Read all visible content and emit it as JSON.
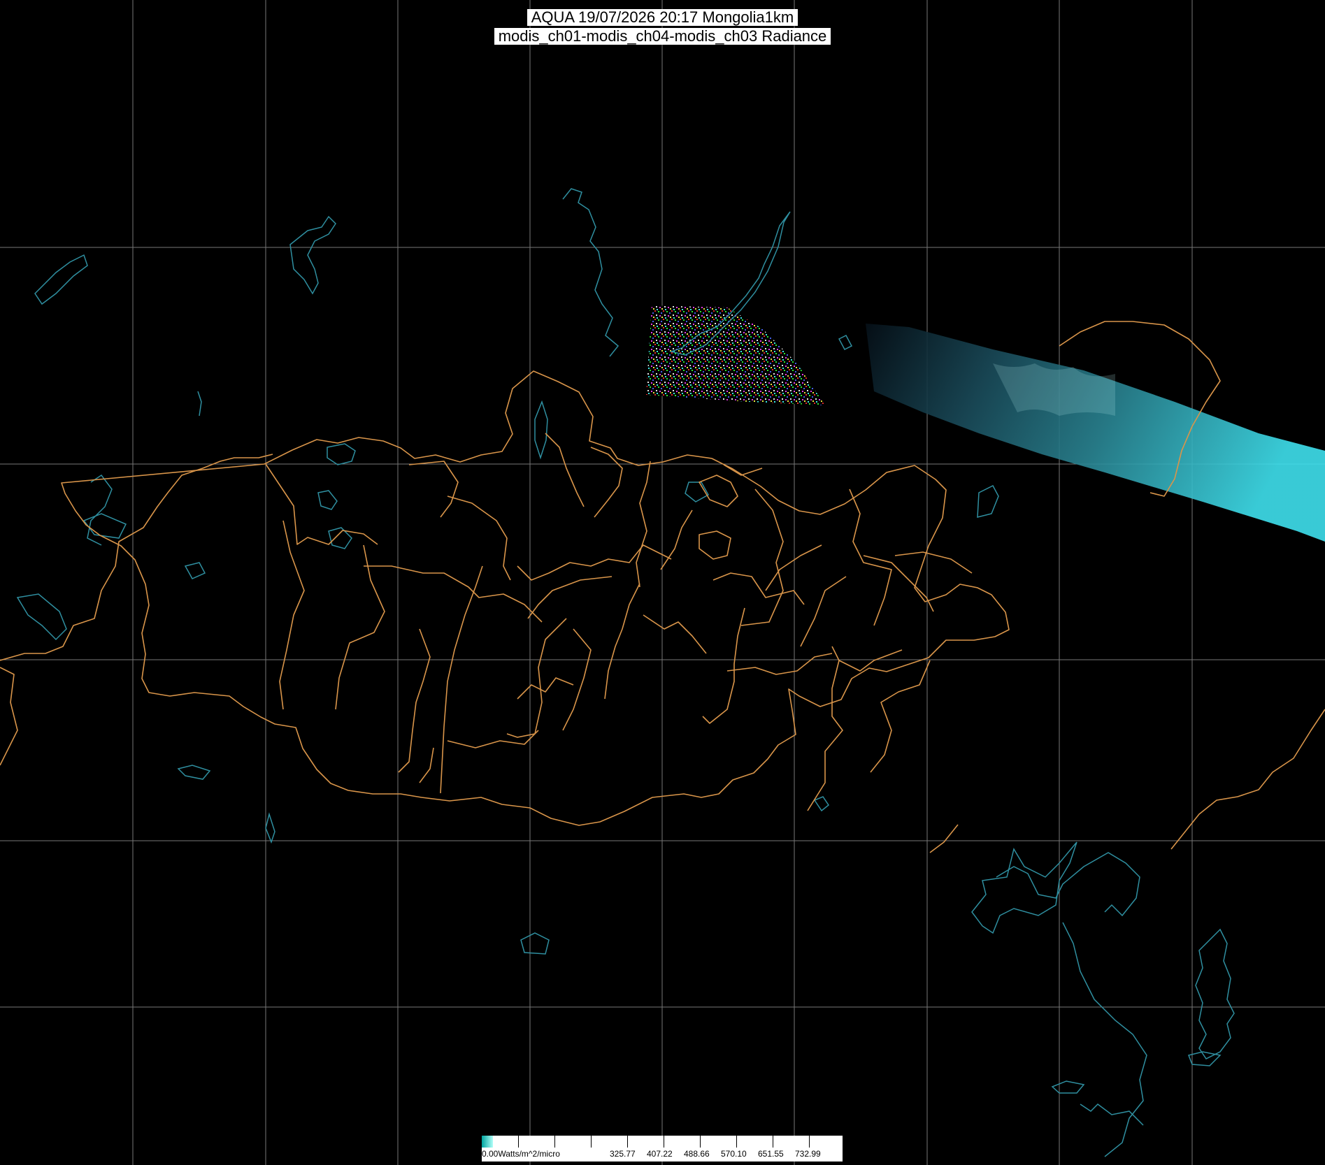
{
  "title": {
    "line1": "AQUA 19/07/2026 20:17 Mongolia1km",
    "line2": "modis_ch01-modis_ch04-modis_ch03 Radiance"
  },
  "colors": {
    "background": "#000000",
    "graticule": "#777777",
    "borders": "#d9954a",
    "water": "#2f8fa0",
    "swath": "#2fb7c3"
  },
  "colorbar": {
    "unit_label": "0.00Watts/m^2/micro",
    "tick_labels": [
      "325.77",
      "407.22",
      "488.66",
      "570.10",
      "651.55",
      "732.99"
    ]
  }
}
